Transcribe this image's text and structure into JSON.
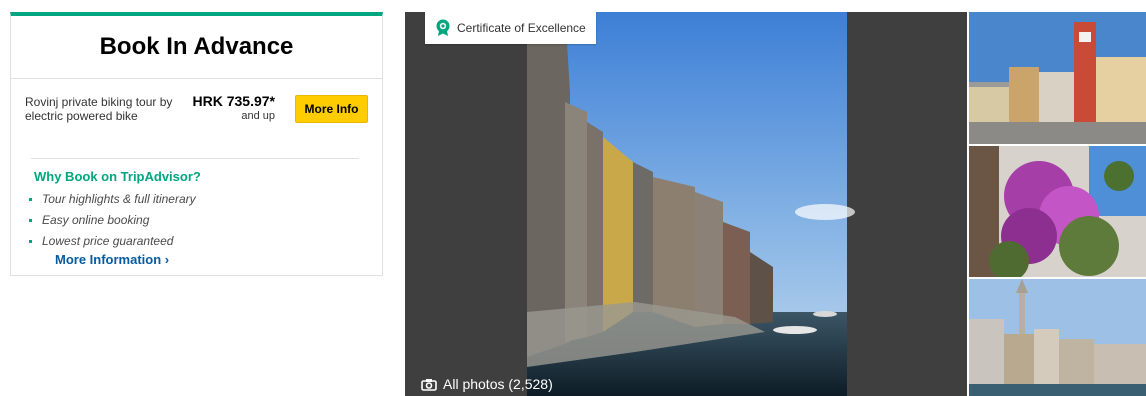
{
  "booking": {
    "title": "Book In Advance",
    "offer": {
      "name": "Rovinj private biking tour by electric powered bike",
      "price": "HRK 735.97*",
      "price_suffix": "and up",
      "button_label": "More Info"
    },
    "why": {
      "title": "Why Book on TripAdvisor?",
      "items": [
        "Tour highlights & full itinerary",
        "Easy online booking",
        "Lowest price guaranteed"
      ],
      "link_label": "More Information ›"
    }
  },
  "gallery": {
    "badge": "Certificate of Excellence",
    "all_photos_label": "All photos (2,528)"
  },
  "colors": {
    "brand_green": "#00a680",
    "button_yellow": "#ffcc00",
    "link_blue": "#065a9e"
  },
  "icons": {
    "badge": "certificate-owl-icon",
    "camera": "camera-icon"
  }
}
